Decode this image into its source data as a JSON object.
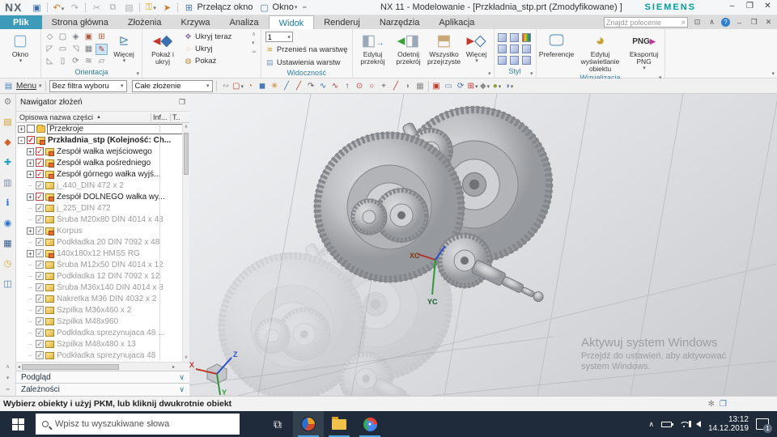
{
  "titlebar": {
    "logo": "NX",
    "switch_window_label": "Przełącz okno",
    "window_menu_label": "Okno",
    "title": "NX 11 - Modelowanie - [Przkładnia_stp.prt (Zmodyfikowane) ]",
    "brand": "SIEMENS",
    "minimize": "–",
    "restore": "❐",
    "close": "✕"
  },
  "tabs": {
    "file": "Plik",
    "items": [
      "Strona główna",
      "Złożenia",
      "Krzywa",
      "Analiza",
      "Widok",
      "Renderuj",
      "Narzędzia",
      "Aplikacja"
    ],
    "active": "Widok",
    "search_placeholder": "Znajdź polecenie"
  },
  "ribbon": {
    "okno_label": "Okno",
    "orientacja_label": "Orientacja",
    "wiecej_label": "Więcej",
    "pokaz_ukryj_label": "Pokaż i ukryj",
    "hide_list": [
      "Ukryj teraz",
      "Ukryj",
      "Pokaż"
    ],
    "layer_value": "1",
    "widocznosc_label": "Widoczność",
    "widocznosc_items": [
      "Przenieś na warstwę",
      "Ustawienia warstw"
    ],
    "section_buttons": [
      "Edytuj przekrój",
      "Odetnij przekrój",
      "Wszystko przejrzyste",
      "Więcej"
    ],
    "styl_label": "Styl",
    "wizualizacja_label": "Wizualizacja",
    "wizualizacja_buttons": [
      "Preferencje",
      "Edytuj wyświetlanie obiektu",
      "Eksportuj PNG"
    ],
    "png_icon_text": "PNG"
  },
  "toolbar": {
    "menu_label": "Menu",
    "filter_value": "Bez filtra wyboru",
    "scope_value": "Całe złożenie",
    "icons": [
      {
        "name": "selection-chain-icon",
        "glyph": "∾",
        "color": "#9a9a9a"
      },
      {
        "name": "select-rectangle-icon",
        "glyph": "▢",
        "color": "#c0392b",
        "drop": true
      },
      {
        "name": "snap-angle-icon",
        "glyph": "◔",
        "color": "#c87820"
      },
      {
        "name": "work-cube-icon",
        "glyph": "◼",
        "color": "#4a7ab8"
      },
      {
        "name": "snap-point-icon",
        "glyph": "✳",
        "color": "#c87820"
      },
      {
        "name": "line-icon",
        "glyph": "╱",
        "color": "#3a6fb0"
      },
      {
        "name": "line-endpoint-icon",
        "glyph": "╱",
        "color": "#b03a3a"
      },
      {
        "name": "arc-icon",
        "glyph": "↷",
        "color": "#555555"
      },
      {
        "name": "spline-icon",
        "glyph": "∿",
        "color": "#3a6fb0"
      },
      {
        "name": "curve-icon",
        "glyph": "∿",
        "color": "#b03a3a"
      },
      {
        "name": "vector-icon",
        "glyph": "↑",
        "color": "#555555"
      },
      {
        "name": "point-circle-icon",
        "glyph": "⊙",
        "color": "#c03a3a"
      },
      {
        "name": "circle-icon",
        "glyph": "○",
        "color": "#c03a3a"
      },
      {
        "name": "plus-icon",
        "glyph": "+",
        "color": "#555555"
      },
      {
        "name": "slash-icon",
        "glyph": "╱",
        "color": "#b03a3a"
      },
      {
        "name": "face-icon",
        "glyph": "◗",
        "color": "#8a8a8a"
      },
      {
        "name": "mesh-icon",
        "glyph": "▦",
        "color": "#8a8a8a"
      },
      {
        "name": "sep",
        "glyph": "",
        "color": ""
      },
      {
        "name": "zoom-fit-icon",
        "glyph": "▣",
        "color": "#c0392b"
      },
      {
        "name": "pan-icon",
        "glyph": "▭",
        "color": "#6a8ab0"
      },
      {
        "name": "rotate-icon",
        "glyph": "⟳",
        "color": "#3a6fb0"
      },
      {
        "name": "multiview-icon",
        "glyph": "⊞",
        "color": "#c0392b",
        "drop": true
      },
      {
        "name": "iso-view-icon",
        "glyph": "◆",
        "color": "#8a8a8a",
        "drop": true
      },
      {
        "name": "shaded-icon",
        "glyph": "●",
        "color": "#8a9a3a",
        "drop": true
      },
      {
        "name": "clip-icon",
        "glyph": "◑",
        "color": "#5a7ab0",
        "drop": true
      }
    ]
  },
  "strip": {
    "icons": [
      {
        "name": "gear-icon",
        "glyph": "⚙",
        "color": "#8a8a8a"
      },
      {
        "name": "assembly-navigator-icon",
        "glyph": "▤",
        "color": "#d29a2a"
      },
      {
        "name": "constraint-navigator-icon",
        "glyph": "◆",
        "color": "#d2622a"
      },
      {
        "name": "part-navigator-icon",
        "glyph": "✚",
        "color": "#2aa0b8"
      },
      {
        "name": "reuse-library-icon",
        "glyph": "▥",
        "color": "#7a8aa0"
      },
      {
        "name": "info-icon",
        "glyph": "ℹ",
        "color": "#2a6fd2"
      },
      {
        "name": "web-browser-icon",
        "glyph": "◉",
        "color": "#2a6fd2"
      },
      {
        "name": "notes-icon",
        "glyph": "▦",
        "color": "#3a5a8a"
      },
      {
        "name": "history-icon",
        "glyph": "◷",
        "color": "#d2a02a"
      },
      {
        "name": "process-studio-icon",
        "glyph": "◫",
        "color": "#4a7ab0"
      }
    ]
  },
  "navigator": {
    "title": "Nawigator złożeń",
    "columns": {
      "name": "Opisowa nazwa części",
      "info": "Inf...",
      "t": "T.."
    },
    "tree": [
      {
        "expander": "+",
        "check": "empty",
        "icon": "folder",
        "label": "Przekroje",
        "indent": 0,
        "boxed": true
      },
      {
        "expander": "-",
        "check": "red",
        "icon": "assembly",
        "label": "Przkładnia_stp (Kolejność: Ch...",
        "indent": 0,
        "bold": true
      },
      {
        "expander": "+",
        "check": "red",
        "icon": "assembly",
        "label": "Zespół wałka wejściowego",
        "indent": 1
      },
      {
        "expander": "+",
        "check": "red",
        "icon": "assembly",
        "label": "Zespół wałka pośredniego",
        "indent": 1
      },
      {
        "expander": "+",
        "check": "red",
        "icon": "assembly",
        "label": "Zespół górnego wałka wyjś...",
        "indent": 1
      },
      {
        "expander": "",
        "check": "gray",
        "icon": "part",
        "label": "j_440_DIN 472 x 2",
        "indent": 1,
        "gray": true
      },
      {
        "expander": "+",
        "check": "red",
        "icon": "assembly",
        "label": "Zespół DOLNEGO wałka wy...",
        "indent": 1
      },
      {
        "expander": "",
        "check": "gray",
        "icon": "part",
        "label": "j_225_DIN 472",
        "indent": 1,
        "gray": true
      },
      {
        "expander": "",
        "check": "gray",
        "icon": "part",
        "label": "Śruba M20x80 DIN 4014 x 48",
        "indent": 1,
        "gray": true
      },
      {
        "expander": "+",
        "check": "gray",
        "icon": "assembly",
        "label": "Korpus",
        "indent": 1,
        "gray": true
      },
      {
        "expander": "",
        "check": "gray",
        "icon": "part",
        "label": "Podkładka 20 DIN 7092 x 48",
        "indent": 1,
        "gray": true
      },
      {
        "expander": "+",
        "check": "gray",
        "icon": "assembly",
        "label": "140x180x12 HMS5 RG",
        "indent": 1,
        "gray": true
      },
      {
        "expander": "",
        "check": "gray",
        "icon": "part",
        "label": "Śruba M12x50 DIN 4014 x 12",
        "indent": 1,
        "gray": true
      },
      {
        "expander": "",
        "check": "gray",
        "icon": "part",
        "label": "Podkładka 12 DIN 7092 x 12",
        "indent": 1,
        "gray": true
      },
      {
        "expander": "",
        "check": "gray",
        "icon": "part",
        "label": "Śruba M36x140 DIN 4014 x 8",
        "indent": 1,
        "gray": true
      },
      {
        "expander": "",
        "check": "gray",
        "icon": "part",
        "label": "Nakretka M36 DIN 4032 x 2",
        "indent": 1,
        "gray": true
      },
      {
        "expander": "",
        "check": "gray",
        "icon": "part",
        "label": "Szpilka M36x460 x 2",
        "indent": 1,
        "gray": true
      },
      {
        "expander": "",
        "check": "gray",
        "icon": "part",
        "label": "Szpilka M48x960",
        "indent": 1,
        "gray": true
      },
      {
        "expander": "",
        "check": "gray",
        "icon": "part",
        "label": "Podkładka sprezynujaca 48 ...",
        "indent": 1,
        "gray": true
      },
      {
        "expander": "",
        "check": "gray",
        "icon": "part",
        "label": "Szpilka M48x480 x 13",
        "indent": 1,
        "gray": true
      },
      {
        "expander": "",
        "check": "gray",
        "icon": "part",
        "label": "Podkładka sprezynujaca 48",
        "indent": 1,
        "gray": true
      }
    ],
    "sections": [
      "Podgląd",
      "Zależności"
    ]
  },
  "viewport": {
    "watermark_title": "Aktywuj system Windows",
    "watermark_sub": "Przejdź do ustawień, aby aktywować system Windows.",
    "triad": {
      "x": "X",
      "y": "Y",
      "z": "Z"
    },
    "csys": {
      "xc": "XC",
      "yc": "YC"
    }
  },
  "statusbar": {
    "message": "Wybierz obiekty i użyj PKM, lub kliknij dwukrotnie obiekt"
  },
  "taskbar": {
    "search_placeholder": "Wpisz tu wyszukiwane słowa",
    "time": "13:12",
    "date": "14.12.2019",
    "notification_count": "1"
  }
}
